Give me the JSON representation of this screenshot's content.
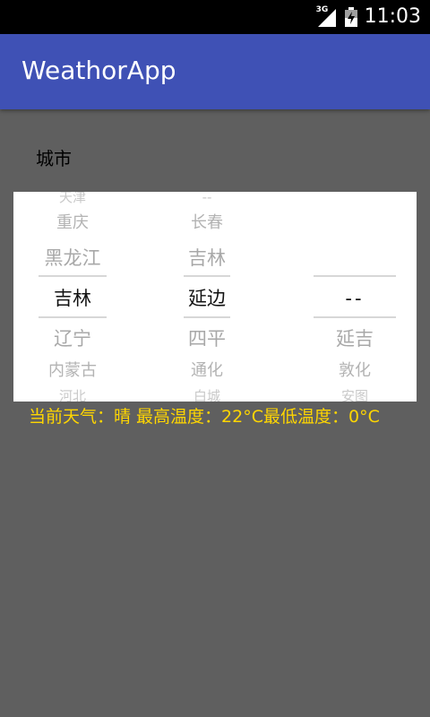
{
  "status_bar": {
    "network": "3G",
    "time": "11:03",
    "icons": [
      "signal-icon",
      "battery-icon"
    ]
  },
  "app_bar": {
    "title": "WeathorApp",
    "color": "#3f51b5"
  },
  "city_label": "城市",
  "picker": {
    "province_wheel": {
      "items": [
        "天津",
        "重庆",
        "黑龙江",
        "吉林",
        "辽宁",
        "内蒙古",
        "河北"
      ],
      "selected": "吉林"
    },
    "city_wheel": {
      "items": [
        "--",
        "长春",
        "吉林",
        "延边",
        "四平",
        "通化",
        "白城"
      ],
      "selected": "延边"
    },
    "district_wheel": {
      "items": [
        "--",
        "延吉",
        "敦化",
        "安图"
      ],
      "selected": "--"
    }
  },
  "weather": {
    "text": "当前天气：晴    最高温度：22°C最低温度：0°C",
    "color": "#ffd600"
  }
}
